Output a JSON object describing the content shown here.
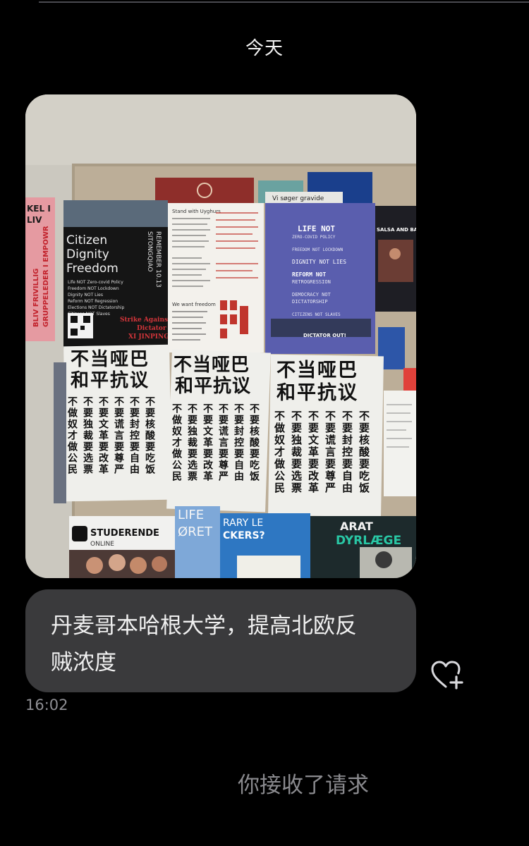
{
  "conversation": {
    "date_header": "今天",
    "message": {
      "text_line1": "丹麦哥本哈根大学，提高北欧反",
      "text_line2": "贼浓度",
      "timestamp": "16:02"
    },
    "system_notice": "你接收了请求"
  },
  "photo": {
    "poster_black": {
      "title_1": "Citizen",
      "title_2": "Dignity",
      "title_3": "Freedom",
      "side_1": "REMEMBER 10.13",
      "side_2": "SITONGQIAO",
      "slogans": [
        "Life NOT Zero-covid Policy",
        "Freedom NOT Lockdown",
        "Dignity NOT Lies",
        "Reform NOT Regression",
        "Elections NOT Dictatorship",
        "Citizens NOT Slaves"
      ],
      "strike_1": "Strike Against",
      "strike_2": "Dictator",
      "strike_3": "XI JINPING"
    },
    "poster_blue": {
      "lines": [
        "LIFE NOT",
        "ZERO-COVID POLICY",
        "FREEDOM NOT LOCKDOWN",
        "DIGNITY NOT LIES",
        "REFORM NOT",
        "RETROGRESSION",
        "DEMOCRACY NOT",
        "DICTATORSHIP",
        "CITIZENS NOT SLAVES"
      ],
      "footer": "DICTATOR OUT!"
    },
    "chinese_poster": {
      "header_1": "不当哑巴",
      "header_2": "和平抗议",
      "columns": [
        "不做奴才做公民",
        "不要独裁要选票",
        "不要文革要改革",
        "不要谎言要尊严",
        "不要封控要自由",
        "不要核酸要吃饭"
      ]
    },
    "left_banner": [
      "KEL I",
      "LIV",
      "BLIV FRIVILLIG",
      "GRUPPELEDER I EMPOWR"
    ],
    "handwritten_1": "Stand with Uyghurs",
    "handwritten_2": "We want freedom",
    "sign_studerende": "STUDERENDE",
    "sign_online": "ONLINE",
    "sign_life": "LIFE",
    "sign_oret": "ØRET",
    "sign_library": "RARY LE",
    "sign_lockers": "CKERS?",
    "sign_dyrlaege": "DYRLÆGE",
    "sign_arat": "ARAT",
    "sign_salsa": "SALSA AND BACH",
    "sign_viseger": "Vi søger gravide"
  },
  "colors": {
    "background": "#000000",
    "bubble": "#3a3a3c",
    "text": "#f0f0f0",
    "muted": "#8e8e93"
  },
  "icons": {
    "like": "heart-plus-icon"
  }
}
